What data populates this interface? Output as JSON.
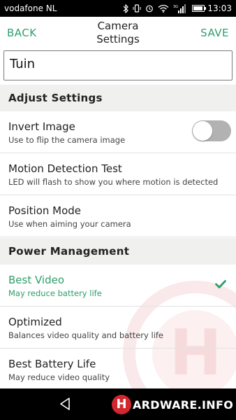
{
  "status_bar": {
    "carrier": "vodafone NL",
    "time": "13:03",
    "battery_level_percent": 90,
    "icons": [
      "bluetooth-icon",
      "vibrate-icon",
      "alarm-icon",
      "wifi-icon",
      "signal-3g-icon",
      "battery-icon"
    ],
    "network_label": "3G"
  },
  "header": {
    "back_label": "BACK",
    "title": "Camera\nSettings",
    "save_label": "SAVE"
  },
  "name_field": {
    "value": "Tuin"
  },
  "sections": {
    "adjust": {
      "title": "Adjust Settings",
      "rows": [
        {
          "title": "Invert Image",
          "subtitle": "Use to flip the camera image",
          "toggle_on": false
        },
        {
          "title": "Motion Detection Test",
          "subtitle": "LED will flash to show you where motion is detected"
        },
        {
          "title": "Position Mode",
          "subtitle": "Use when aiming your camera"
        }
      ]
    },
    "power": {
      "title": "Power Management",
      "rows": [
        {
          "title": "Best Video",
          "subtitle": "May reduce battery life",
          "selected": true
        },
        {
          "title": "Optimized",
          "subtitle": "Balances video quality and battery life",
          "selected": false
        },
        {
          "title": "Best Battery Life",
          "subtitle": "May reduce video quality",
          "selected": false
        }
      ]
    }
  },
  "nav_bar": {
    "watermark_letter": "H",
    "watermark_text": "ARDWARE.INFO"
  },
  "colors": {
    "accent": "#2e9e6b",
    "section_bg": "#f0f0ee",
    "toggle_off": "#b2b2b2",
    "watermark_red": "#d0282e"
  }
}
